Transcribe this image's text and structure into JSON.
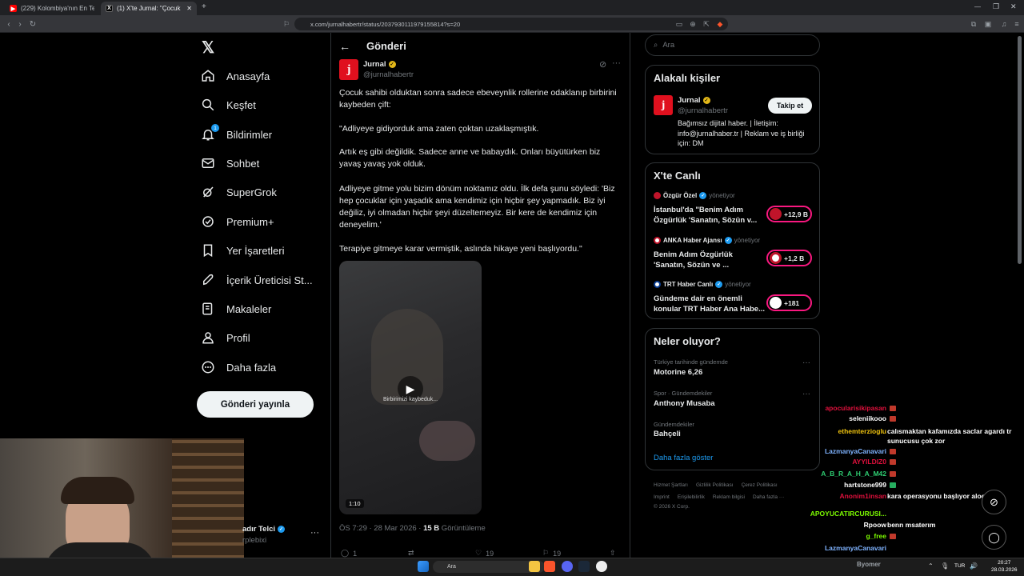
{
  "browser": {
    "tabs": [
      {
        "title": "(229) Kolombiya'nın En Tehlikeli Hapı...",
        "icon": "youtube-icon"
      },
      {
        "title": "(1) X'te Jurnal: \"Çocuk sahibi old...",
        "icon": "x-icon",
        "close": "✕"
      }
    ],
    "url": "x.com/jurnalhabertr/status/2037930111979155814?s=20"
  },
  "nav": {
    "logo": "𝕏",
    "items": [
      {
        "label": "Anasayfa",
        "icon": "home-icon"
      },
      {
        "label": "Keşfet",
        "icon": "search-icon"
      },
      {
        "label": "Bildirimler",
        "icon": "bell-icon",
        "badge": "1"
      },
      {
        "label": "Sohbet",
        "icon": "mail-icon"
      },
      {
        "label": "SuperGrok",
        "icon": "grok-icon"
      },
      {
        "label": "Premium+",
        "icon": "premium-icon"
      },
      {
        "label": "Yer İşaretleri",
        "icon": "bookmark-icon"
      },
      {
        "label": "İçerik Üreticisi St...",
        "icon": "rocket-icon"
      },
      {
        "label": "Makaleler",
        "icon": "article-icon"
      },
      {
        "label": "Profil",
        "icon": "person-icon"
      },
      {
        "label": "Daha fazla",
        "icon": "more-circle-icon"
      }
    ],
    "post_button": "Gönderi yayınla",
    "account_name": "adır Telci",
    "account_handle": "rplebixi"
  },
  "post": {
    "header_title": "Gönderi",
    "author_name": "Jurnal",
    "author_handle": "@jurnalhabertr",
    "avatar_letter": "j",
    "paragraphs": [
      "Çocuk sahibi olduktan sonra sadece ebeveynlik rollerine odaklanıp birbirini kaybeden çift:",
      "\"Adliyeye gidiyorduk ama zaten çoktan uzaklaşmıştık.",
      "Artık eş gibi değildik. Sadece anne ve babaydık. Onları büyütürken biz yavaş yavaş yok olduk.",
      "Adliyeye gitme yolu bizim dönüm noktamız oldu. İlk defa şunu söyledi: 'Biz hep çocuklar için yaşadık ama kendimiz için hiçbir şey yapmadık. Biz iyi değiliz, iyi olmadan hiçbir şeyi düzeltemeyiz. Bir kere de kendimiz için deneyelim.'",
      "Terapiye gitmeye karar vermiştik, aslında hikaye yeni başlıyordu.\""
    ],
    "video_caption": "Birbirimizi kaybeduk...",
    "video_duration": "1:10",
    "time": "ÖS 7:29 · 28 Mar 2026 · ",
    "views": "15 B",
    "views_label": " Görüntüleme",
    "actions": [
      {
        "icon": "reply-icon",
        "count": "1"
      },
      {
        "icon": "repost-icon",
        "count": ""
      },
      {
        "icon": "like-icon",
        "count": "19"
      },
      {
        "icon": "bookmark-icon",
        "count": "19"
      },
      {
        "icon": "share-icon",
        "count": ""
      }
    ]
  },
  "sidebar": {
    "search_placeholder": "Ara",
    "related": {
      "title": "Alakalı kişiler",
      "name": "Jurnal",
      "handle": "@jurnalhabertr",
      "follow": "Takip et",
      "bio": "Bağımsız dijital haber. | İletişim: info@jurnalhaber.tr | Reklam ve iş birliği için: DM"
    },
    "live": {
      "title": "X'te Canlı",
      "items": [
        {
          "host": "Özgür Özel",
          "verified": "yes",
          "status": "yönetiyor",
          "title": "İstanbul'da \"Benim Adım Özgürlük 'Sanatın, Sözün v...",
          "count": "+12,9 B"
        },
        {
          "host": "ANKA Haber Ajansı",
          "verified": "yes",
          "status": "yönetiyor",
          "title": "Benim Adım Özgürlük 'Sanatın, Sözün ve ...",
          "count": "+1,2 B"
        },
        {
          "host": "TRT Haber Canlı",
          "verified": "yes",
          "status": "yönetiyor",
          "title": "Gündeme dair en önemli konular TRT Haber Ana Habe...",
          "count": "+181"
        }
      ]
    },
    "trends": {
      "title": "Neler oluyor?",
      "items": [
        {
          "category": "Türkiye tarihinde gündemde",
          "name": "Motorine 6,26"
        },
        {
          "category": "Spor · Gündemdekiler",
          "name": "Anthony Musaba"
        },
        {
          "category": "Gündemdekiler",
          "name": "Bahçeli"
        }
      ],
      "show_more": "Daha fazla göster"
    },
    "footer": {
      "line1": [
        "Hizmet Şartları",
        "Gizlilik Politikası",
        "Çerez Politikası"
      ],
      "line2": [
        "Imprint",
        "Erişilebilirlik",
        "Reklam bilgisi",
        "Daha fazla ···"
      ],
      "copyright": "© 2026 X Corp."
    }
  },
  "chat": {
    "users": [
      {
        "name": "apocularisikipasan",
        "color": "#e0103c"
      },
      {
        "name": "seleniikooo",
        "color": "#ffffff"
      },
      {
        "name": "ethemterzioglu",
        "color": "#f1c40f"
      },
      {
        "name": "LazmanyaCanavari",
        "color": "#7fb3ff"
      },
      {
        "name": "AYYILDIZ0",
        "color": "#e0103c"
      },
      {
        "name": "A_B_R_A_H_A_M42",
        "color": "#2ecc71"
      },
      {
        "name": "hartstone999",
        "color": "#ffffff"
      },
      {
        "name": "Anonim1insan",
        "color": "#e0103c"
      },
      {
        "name": "APOYUCATIRCURUSI...",
        "color": "#7cfc00"
      },
      {
        "name": "Rpoow",
        "color": "#ffffff"
      },
      {
        "name": "g_free",
        "color": "#7cfc00"
      },
      {
        "name": "LazmanyaCanavari",
        "color": "#7fb3ff"
      }
    ],
    "messages": [
      "calısmaktan kafamızda saclar agardı tr sunucusu çok zor",
      "kara operasyonu başlıyor aloooo",
      "benn msaterım"
    ]
  },
  "taskbar": {
    "search": "Ara",
    "user": "Byomer",
    "lang": "TUR",
    "time": "20:27",
    "date": "28.03.2026"
  },
  "colors": {
    "accent": "#1d9bf0",
    "live": "#f91880",
    "brand_red": "#e0101e"
  }
}
